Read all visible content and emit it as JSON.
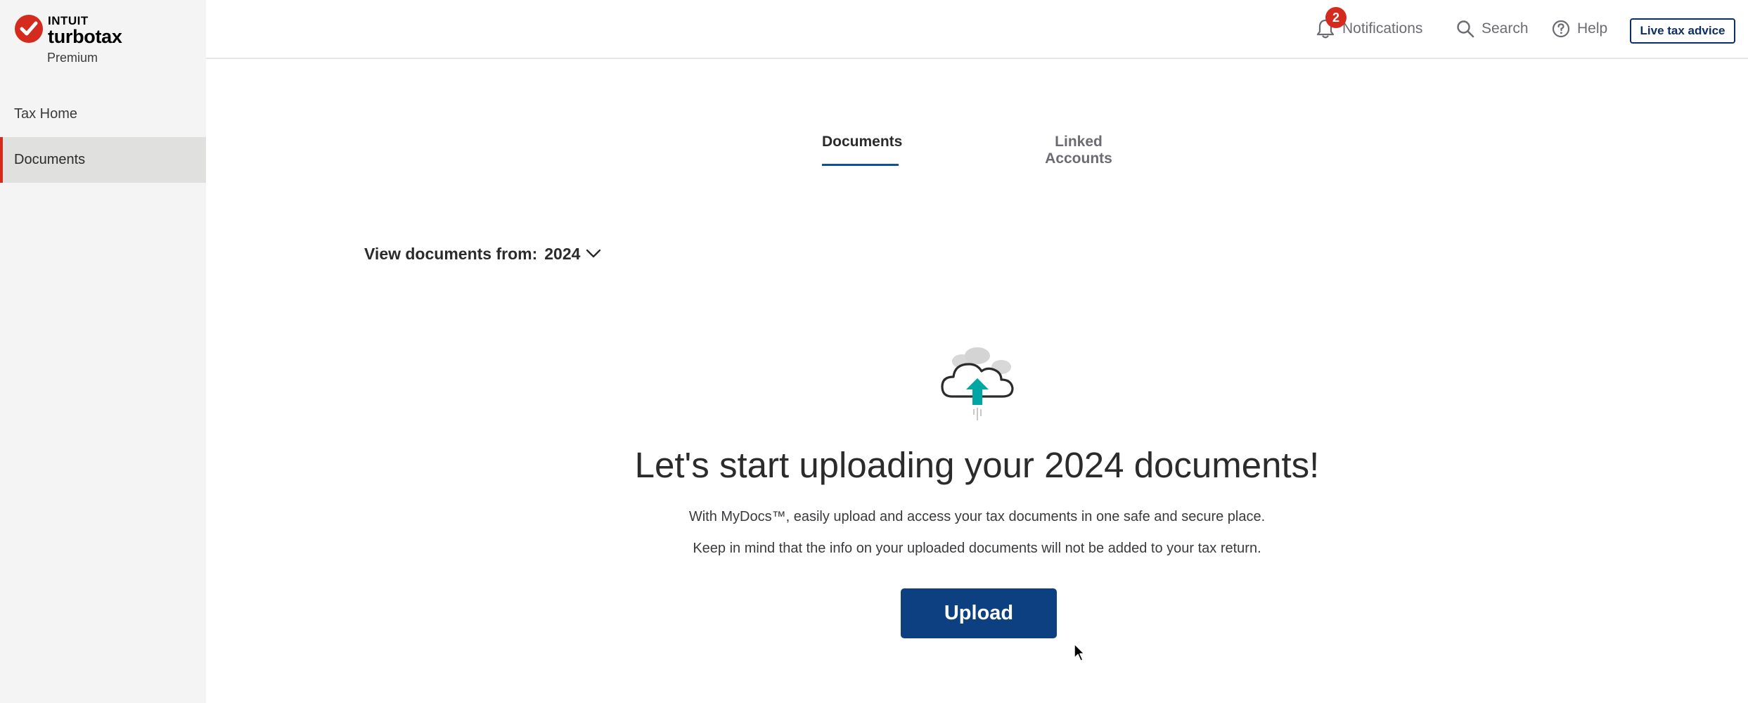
{
  "brand": {
    "company": "INTUIT",
    "product": "turbotax",
    "edition": "Premium",
    "color": "#d52b1e"
  },
  "sidebar": {
    "items": [
      {
        "label": "Tax Home",
        "active": false
      },
      {
        "label": "Documents",
        "active": true
      }
    ]
  },
  "header": {
    "notifications": {
      "label": "Notifications",
      "badge": "2",
      "icon": "bell-icon"
    },
    "search": {
      "label": "Search",
      "icon": "search-icon"
    },
    "help": {
      "label": "Help",
      "icon": "help-icon"
    },
    "live_advice": {
      "label": "Live tax advice"
    }
  },
  "tabs": [
    {
      "label": "Documents",
      "active": true
    },
    {
      "label": "Linked Accounts",
      "active": false
    }
  ],
  "filter": {
    "label": "View documents from:",
    "selected": "2024"
  },
  "empty_state": {
    "icon": "cloud-upload-icon",
    "headline": "Let's start uploading your 2024 documents!",
    "subtext1": "With MyDocs™, easily upload and access your tax documents in one safe and secure place.",
    "subtext2": "Keep in mind that the info on your uploaded documents will not be added to your tax return.",
    "button": "Upload"
  },
  "colors": {
    "primary_button": "#0d4080",
    "tab_underline": "#0d4ea6",
    "accent_teal": "#00a6a4",
    "badge": "#d52b1e"
  }
}
